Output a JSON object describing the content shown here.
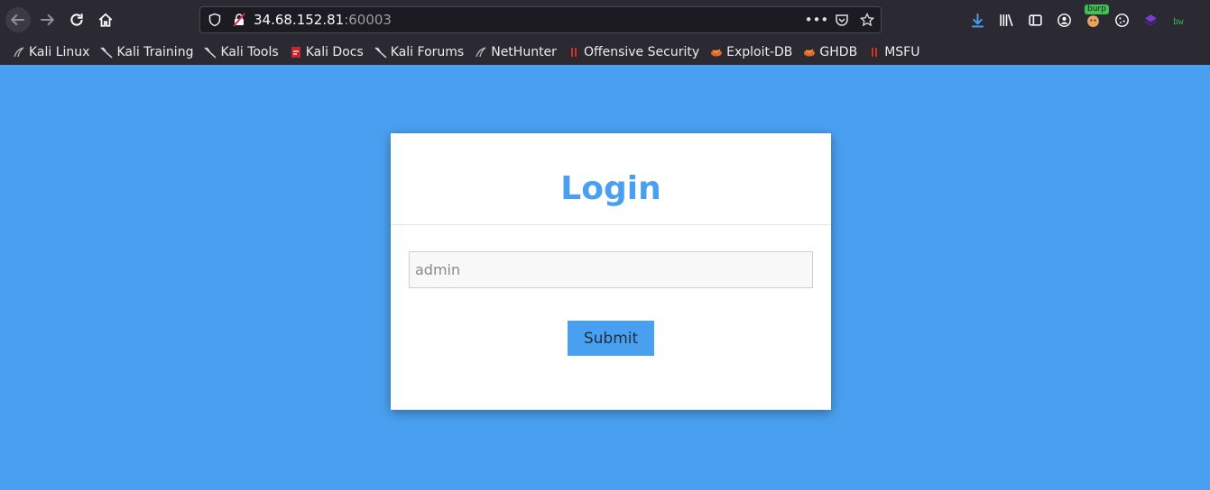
{
  "browser": {
    "url_host": "34.68.152.81",
    "url_port": ":60003",
    "extension_badge": "burp"
  },
  "bookmarks": [
    {
      "label": "Kali Linux",
      "icon": "kali-dragon-icon"
    },
    {
      "label": "Kali Training",
      "icon": "kali-dragon-icon"
    },
    {
      "label": "Kali Tools",
      "icon": "kali-dragon-icon"
    },
    {
      "label": "Kali Docs",
      "icon": "kali-docs-icon"
    },
    {
      "label": "Kali Forums",
      "icon": "kali-dragon-icon"
    },
    {
      "label": "NetHunter",
      "icon": "nethunter-icon"
    },
    {
      "label": "Offensive Security",
      "icon": "offsec-icon"
    },
    {
      "label": "Exploit-DB",
      "icon": "exploitdb-icon"
    },
    {
      "label": "GHDB",
      "icon": "exploitdb-icon"
    },
    {
      "label": "MSFU",
      "icon": "offsec-icon"
    }
  ],
  "login": {
    "title": "Login",
    "username_placeholder": "admin",
    "submit_label": "Submit"
  },
  "colors": {
    "background": "#4aa0f0",
    "card": "#ffffff",
    "toolbar": "#2b2a33"
  }
}
